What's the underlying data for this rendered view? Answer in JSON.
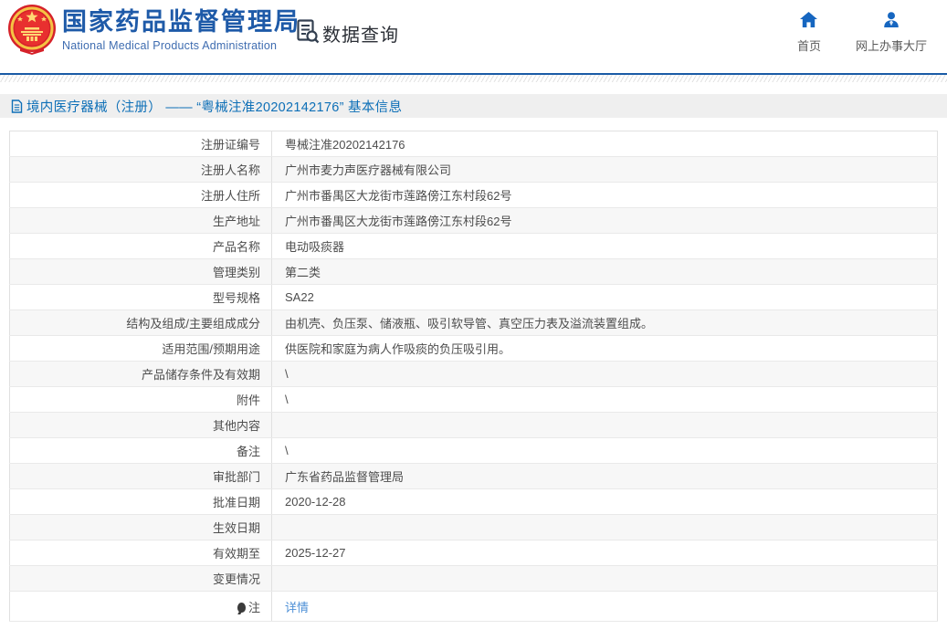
{
  "header": {
    "brand_title": "国家药品监督管理局",
    "brand_subtitle": "National Medical Products Administration",
    "nav": {
      "data_query": "数据查询",
      "home": "首页",
      "online_hall": "网上办事大厅"
    }
  },
  "breadcrumb": {
    "title": "境内医疗器械（注册） —— “粤械注准20202142176” 基本信息"
  },
  "detail_table": {
    "rows": [
      {
        "label": "注册证编号",
        "value": "粤械注准20202142176"
      },
      {
        "label": "注册人名称",
        "value": "广州市麦力声医疗器械有限公司"
      },
      {
        "label": "注册人住所",
        "value": "广州市番禺区大龙街市莲路傍江东村段62号"
      },
      {
        "label": "生产地址",
        "value": "广州市番禺区大龙街市莲路傍江东村段62号"
      },
      {
        "label": "产品名称",
        "value": "电动吸痰器"
      },
      {
        "label": "管理类别",
        "value": "第二类"
      },
      {
        "label": "型号规格",
        "value": "SA22"
      },
      {
        "label": "结构及组成/主要组成成分",
        "value": "由机壳、负压泵、储液瓶、吸引软导管、真空压力表及溢流装置组成。"
      },
      {
        "label": "适用范围/预期用途",
        "value": "供医院和家庭为病人作吸痰的负压吸引用。"
      },
      {
        "label": "产品储存条件及有效期",
        "value": "\\"
      },
      {
        "label": "附件",
        "value": "\\"
      },
      {
        "label": "其他内容",
        "value": ""
      },
      {
        "label": "备注",
        "value": "\\"
      },
      {
        "label": "审批部门",
        "value": "广东省药品监督管理局"
      },
      {
        "label": "批准日期",
        "value": "2020-12-28"
      },
      {
        "label": "生效日期",
        "value": ""
      },
      {
        "label": "有效期至",
        "value": "2025-12-27"
      },
      {
        "label": "变更情况",
        "value": ""
      },
      {
        "label": "注",
        "value": "详情",
        "label_icon": "note-balloon-icon",
        "value_is_link": true
      }
    ]
  },
  "colors": {
    "brand_blue": "#1e5aa8",
    "accent_line": "#1a5ba6",
    "breadcrumb_blue": "#0d6fb7",
    "icon_blue": "#1666c0",
    "link_blue": "#4d8fd6",
    "row_alt_bg": "#f7f7f7"
  }
}
